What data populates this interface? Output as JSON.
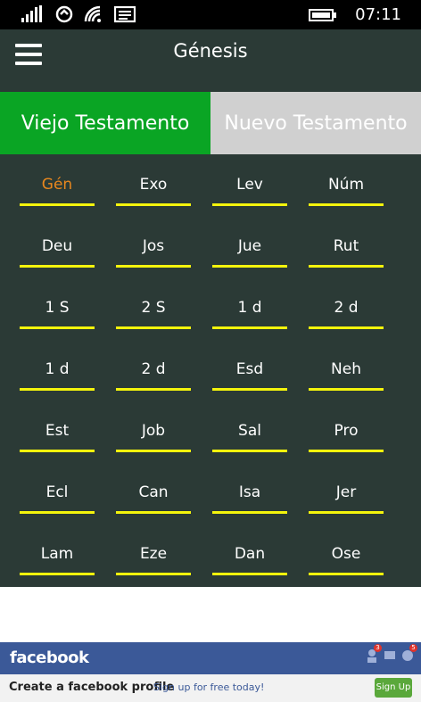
{
  "status_bar": {
    "time": "07:11",
    "icons": [
      "signal-icon",
      "nfc-icon",
      "wifi-icon",
      "message-icon",
      "battery-icon"
    ]
  },
  "header": {
    "title": "Génesis",
    "menu_icon": "hamburger-menu-icon"
  },
  "tabs": [
    {
      "label": "Viejo Testamento",
      "active": true,
      "color": "#0aa524"
    },
    {
      "label": "Nuevo Testamento",
      "active": false,
      "color": "#d0d0d0"
    }
  ],
  "books": [
    [
      "Gén",
      "Exo",
      "Lev",
      "Núm"
    ],
    [
      "Deu",
      "Jos",
      "Jue",
      "Rut"
    ],
    [
      "1 S",
      "2 S",
      "1 d",
      "2 d"
    ],
    [
      "1 d",
      "2 d",
      "Esd",
      "Neh"
    ],
    [
      "Est",
      "Job",
      "Sal",
      "Pro"
    ],
    [
      "Ecl",
      "Can",
      "Isa",
      "Jer"
    ],
    [
      "Lam",
      "Eze",
      "Dan",
      "Ose"
    ]
  ],
  "selected_book": "Gén",
  "colors": {
    "grid_bg": "#2b3a36",
    "underline": "#f4f40c",
    "selected_text": "#e8871e"
  },
  "ad": {
    "brand": "facebook",
    "headline": "Create a facebook profile",
    "subtext": "Sign up for free today!",
    "button": "Sign Up",
    "badges": [
      "3",
      "",
      "5"
    ]
  }
}
